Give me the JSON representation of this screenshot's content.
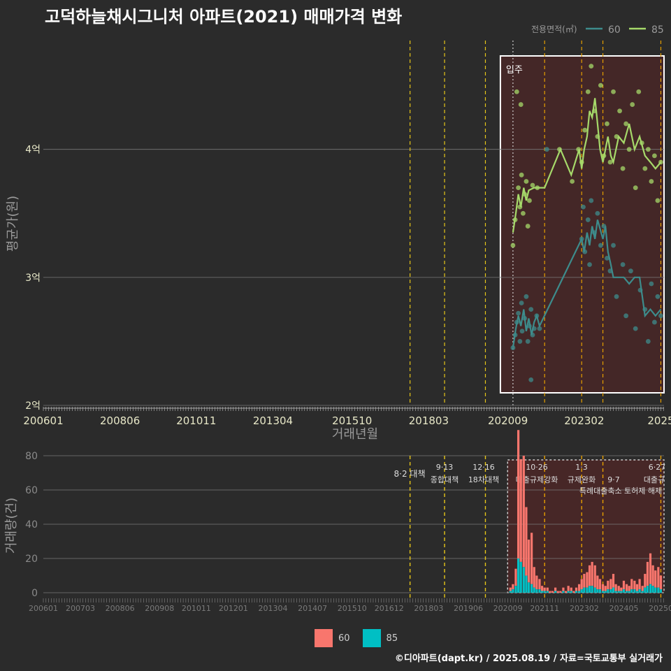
{
  "title": "고덕하늘채시그니처 아파트(2021) 매매가격 변화",
  "footer": "©디아파트(dapt.kr) / 2025.08.19 / 자료=국토교통부 실거래가",
  "colors": {
    "s60_line": "#3d8c8c",
    "s85_line": "#a6d96a",
    "bar60": "#f8766d",
    "bar85": "#00bfc4",
    "region": "#5a2424",
    "policy_yellow": "#e6c619",
    "policy_orange": "#e69f00"
  },
  "chart_data": [
    {
      "type": "line",
      "id": "price",
      "ylabel": "평균가(원)",
      "xlabel": "거래년월",
      "legend": {
        "title": "전용면적(㎡)",
        "entries": [
          "60",
          "85"
        ],
        "placement": "top-right"
      },
      "yticks": [
        {
          "v": 2,
          "label": "2억"
        },
        {
          "v": 3,
          "label": "3억"
        },
        {
          "v": 4,
          "label": "4억"
        }
      ],
      "ylim": [
        2,
        4.85
      ],
      "xlim": [
        2006.0,
        2025.6
      ],
      "xticks": [
        {
          "v": 2006.0,
          "label": "200601"
        },
        {
          "v": 2008.42,
          "label": "200806"
        },
        {
          "v": 2010.83,
          "label": "201011"
        },
        {
          "v": 2013.25,
          "label": "201304"
        },
        {
          "v": 2015.75,
          "label": "201510"
        },
        {
          "v": 2018.17,
          "label": "201803"
        },
        {
          "v": 2020.67,
          "label": "202009"
        },
        {
          "v": 2023.08,
          "label": "202302"
        },
        {
          "v": 2025.5,
          "label": "2025"
        }
      ],
      "annotation": "입주",
      "series": [
        {
          "name": "60",
          "line": [
            [
              2020.83,
              2.45
            ],
            [
              2020.92,
              2.6
            ],
            [
              2021.0,
              2.7
            ],
            [
              2021.08,
              2.62
            ],
            [
              2021.17,
              2.75
            ],
            [
              2021.25,
              2.58
            ],
            [
              2021.33,
              2.68
            ],
            [
              2021.42,
              2.55
            ],
            [
              2021.5,
              2.65
            ],
            [
              2021.58,
              2.7
            ],
            [
              2021.67,
              2.62
            ],
            [
              2023.0,
              3.3
            ],
            [
              2023.08,
              3.2
            ],
            [
              2023.17,
              3.35
            ],
            [
              2023.25,
              3.25
            ],
            [
              2023.33,
              3.4
            ],
            [
              2023.42,
              3.3
            ],
            [
              2023.5,
              3.45
            ],
            [
              2023.58,
              3.38
            ],
            [
              2023.67,
              3.3
            ],
            [
              2023.75,
              3.4
            ],
            [
              2023.83,
              3.2
            ],
            [
              2023.92,
              3.1
            ],
            [
              2024.0,
              3.0
            ],
            [
              2024.17,
              3.0
            ],
            [
              2024.33,
              3.0
            ],
            [
              2024.5,
              2.95
            ],
            [
              2024.67,
              3.0
            ],
            [
              2024.83,
              3.0
            ],
            [
              2025.0,
              2.7
            ],
            [
              2025.17,
              2.75
            ],
            [
              2025.33,
              2.7
            ],
            [
              2025.5,
              2.75
            ]
          ],
          "points": [
            [
              2020.83,
              2.45
            ],
            [
              2020.9,
              2.55
            ],
            [
              2020.95,
              2.65
            ],
            [
              2021.0,
              2.72
            ],
            [
              2021.05,
              2.5
            ],
            [
              2021.1,
              2.8
            ],
            [
              2021.12,
              2.58
            ],
            [
              2021.2,
              2.68
            ],
            [
              2021.25,
              2.85
            ],
            [
              2021.3,
              2.5
            ],
            [
              2021.35,
              2.62
            ],
            [
              2021.4,
              2.75
            ],
            [
              2021.45,
              2.55
            ],
            [
              2021.5,
              2.6
            ],
            [
              2021.58,
              2.7
            ],
            [
              2021.67,
              2.6
            ],
            [
              2021.9,
              4.0
            ],
            [
              2023.0,
              3.3
            ],
            [
              2023.05,
              3.55
            ],
            [
              2023.1,
              3.2
            ],
            [
              2023.2,
              3.45
            ],
            [
              2023.25,
              3.1
            ],
            [
              2023.3,
              3.6
            ],
            [
              2023.4,
              3.35
            ],
            [
              2023.5,
              3.5
            ],
            [
              2023.6,
              3.25
            ],
            [
              2023.7,
              3.4
            ],
            [
              2023.8,
              3.15
            ],
            [
              2023.9,
              3.05
            ],
            [
              2024.0,
              3.25
            ],
            [
              2024.1,
              2.85
            ],
            [
              2024.3,
              3.1
            ],
            [
              2024.4,
              2.7
            ],
            [
              2024.55,
              3.05
            ],
            [
              2024.7,
              2.6
            ],
            [
              2024.85,
              2.9
            ],
            [
              2025.0,
              2.75
            ],
            [
              2025.1,
              2.5
            ],
            [
              2025.2,
              2.95
            ],
            [
              2025.3,
              2.65
            ],
            [
              2025.4,
              2.85
            ],
            [
              2025.5,
              2.7
            ],
            [
              2021.4,
              2.2
            ]
          ]
        },
        {
          "name": "85",
          "line": [
            [
              2020.83,
              3.35
            ],
            [
              2020.92,
              3.5
            ],
            [
              2021.0,
              3.65
            ],
            [
              2021.08,
              3.55
            ],
            [
              2021.17,
              3.7
            ],
            [
              2021.25,
              3.6
            ],
            [
              2021.33,
              3.68
            ],
            [
              2021.5,
              3.7
            ],
            [
              2021.83,
              3.7
            ],
            [
              2022.33,
              4.0
            ],
            [
              2022.67,
              3.8
            ],
            [
              2022.92,
              4.0
            ],
            [
              2023.0,
              3.85
            ],
            [
              2023.08,
              4.0
            ],
            [
              2023.17,
              4.1
            ],
            [
              2023.25,
              4.3
            ],
            [
              2023.33,
              4.25
            ],
            [
              2023.42,
              4.4
            ],
            [
              2023.5,
              4.2
            ],
            [
              2023.58,
              4.0
            ],
            [
              2023.67,
              3.9
            ],
            [
              2023.83,
              4.1
            ],
            [
              2023.92,
              3.95
            ],
            [
              2024.0,
              3.9
            ],
            [
              2024.17,
              4.1
            ],
            [
              2024.33,
              4.05
            ],
            [
              2024.5,
              4.2
            ],
            [
              2024.67,
              4.0
            ],
            [
              2024.83,
              4.1
            ],
            [
              2025.0,
              3.95
            ],
            [
              2025.17,
              3.9
            ],
            [
              2025.33,
              3.85
            ],
            [
              2025.5,
              3.9
            ]
          ],
          "points": [
            [
              2020.83,
              3.25
            ],
            [
              2020.9,
              3.45
            ],
            [
              2020.95,
              4.45
            ],
            [
              2021.0,
              3.7
            ],
            [
              2021.05,
              3.55
            ],
            [
              2021.08,
              4.35
            ],
            [
              2021.1,
              3.8
            ],
            [
              2021.15,
              3.5
            ],
            [
              2021.2,
              3.65
            ],
            [
              2021.25,
              3.75
            ],
            [
              2021.3,
              3.4
            ],
            [
              2021.35,
              3.6
            ],
            [
              2021.45,
              3.72
            ],
            [
              2021.6,
              3.7
            ],
            [
              2022.3,
              4.0
            ],
            [
              2022.7,
              3.75
            ],
            [
              2022.9,
              4.0
            ],
            [
              2023.0,
              3.9
            ],
            [
              2023.1,
              4.15
            ],
            [
              2023.2,
              4.45
            ],
            [
              2023.3,
              4.65
            ],
            [
              2023.4,
              4.3
            ],
            [
              2023.5,
              4.1
            ],
            [
              2023.6,
              4.5
            ],
            [
              2023.7,
              3.95
            ],
            [
              2023.8,
              4.2
            ],
            [
              2023.9,
              3.9
            ],
            [
              2024.0,
              4.45
            ],
            [
              2024.1,
              4.1
            ],
            [
              2024.2,
              4.3
            ],
            [
              2024.3,
              3.85
            ],
            [
              2024.4,
              4.2
            ],
            [
              2024.5,
              4.0
            ],
            [
              2024.6,
              4.35
            ],
            [
              2024.7,
              3.7
            ],
            [
              2024.8,
              4.45
            ],
            [
              2024.9,
              4.05
            ],
            [
              2025.0,
              3.85
            ],
            [
              2025.1,
              4.0
            ],
            [
              2025.2,
              3.75
            ],
            [
              2025.3,
              3.95
            ],
            [
              2025.4,
              3.6
            ],
            [
              2025.5,
              3.9
            ]
          ]
        }
      ]
    },
    {
      "type": "bar",
      "id": "volume",
      "ylabel": "거래량(건)",
      "stacked": true,
      "ylim": [
        0,
        80
      ],
      "yticks": [
        0,
        20,
        40,
        60,
        80
      ],
      "xlim": [
        2006.0,
        2025.6
      ],
      "xticks": [
        {
          "v": 2006.0,
          "label": "200601"
        },
        {
          "v": 2007.17,
          "label": "200703"
        },
        {
          "v": 2008.42,
          "label": "200806"
        },
        {
          "v": 2009.67,
          "label": "200908"
        },
        {
          "v": 2010.83,
          "label": "201011"
        },
        {
          "v": 2012.0,
          "label": "201201"
        },
        {
          "v": 2013.25,
          "label": "201304"
        },
        {
          "v": 2014.5,
          "label": "201407"
        },
        {
          "v": 2015.75,
          "label": "201510"
        },
        {
          "v": 2016.92,
          "label": "201612"
        },
        {
          "v": 2018.17,
          "label": "201803"
        },
        {
          "v": 2019.42,
          "label": "201906"
        },
        {
          "v": 2020.67,
          "label": "202009"
        },
        {
          "v": 2021.83,
          "label": "202111"
        },
        {
          "v": 2023.08,
          "label": "202302"
        },
        {
          "v": 2024.33,
          "label": "202405"
        },
        {
          "v": 2025.5,
          "label": "20250"
        }
      ],
      "legend": {
        "entries": [
          "60",
          "85"
        ],
        "placement": "bottom"
      },
      "months": [
        2020.75,
        2020.83,
        2020.92,
        2021.0,
        2021.08,
        2021.17,
        2021.25,
        2021.33,
        2021.42,
        2021.5,
        2021.58,
        2021.67,
        2021.75,
        2021.83,
        2021.92,
        2022.0,
        2022.08,
        2022.17,
        2022.25,
        2022.33,
        2022.42,
        2022.5,
        2022.58,
        2022.67,
        2022.75,
        2022.83,
        2022.92,
        2023.0,
        2023.08,
        2023.17,
        2023.25,
        2023.33,
        2023.42,
        2023.5,
        2023.58,
        2023.67,
        2023.75,
        2023.83,
        2023.92,
        2024.0,
        2024.08,
        2024.17,
        2024.25,
        2024.33,
        2024.42,
        2024.5,
        2024.58,
        2024.67,
        2024.75,
        2024.83,
        2024.92,
        2025.0,
        2025.08,
        2025.17,
        2025.25,
        2025.33,
        2025.42,
        2025.5
      ],
      "series": [
        {
          "name": "60",
          "values": [
            2,
            3,
            10,
            75,
            60,
            65,
            40,
            25,
            30,
            12,
            8,
            6,
            3,
            2,
            2,
            1,
            1,
            2,
            1,
            1,
            2,
            1,
            3,
            2,
            1,
            2,
            4,
            6,
            8,
            9,
            12,
            14,
            13,
            8,
            6,
            4,
            3,
            5,
            6,
            8,
            4,
            3,
            2,
            5,
            4,
            3,
            6,
            5,
            4,
            6,
            3,
            8,
            14,
            18,
            12,
            10,
            12,
            8
          ]
        },
        {
          "name": "85",
          "values": [
            1,
            2,
            4,
            20,
            18,
            15,
            10,
            6,
            5,
            3,
            2,
            2,
            1,
            1,
            1,
            0,
            0,
            1,
            0,
            0,
            1,
            0,
            1,
            1,
            0,
            1,
            1,
            2,
            3,
            3,
            4,
            4,
            3,
            2,
            2,
            1,
            1,
            2,
            2,
            3,
            1,
            1,
            1,
            2,
            1,
            1,
            2,
            2,
            1,
            2,
            1,
            3,
            4,
            5,
            4,
            3,
            3,
            2
          ]
        }
      ],
      "policies": [
        {
          "x": 2017.58,
          "color": "#e6c619",
          "num": "8·2",
          "text": "대책"
        },
        {
          "x": 2018.67,
          "color": "#e6c619",
          "num": "9·13",
          "text": "종합대책"
        },
        {
          "x": 2019.96,
          "color": "#e6c619",
          "num": "12·16",
          "text": "18차대책"
        },
        {
          "x": 2021.83,
          "color": "#e69f00",
          "num": "10·26",
          "text": "대출규제강화"
        },
        {
          "x": 2023.0,
          "color": "#e69f00",
          "num": "1·3",
          "text": "규제완화"
        },
        {
          "x": 2023.67,
          "color": "#e69f00",
          "num": "9·7",
          "text": "특례대출축소 토허제 해제"
        },
        {
          "x": 2025.5,
          "color": "#e69f00",
          "num": "6·27",
          "text": "대출규"
        }
      ]
    }
  ]
}
